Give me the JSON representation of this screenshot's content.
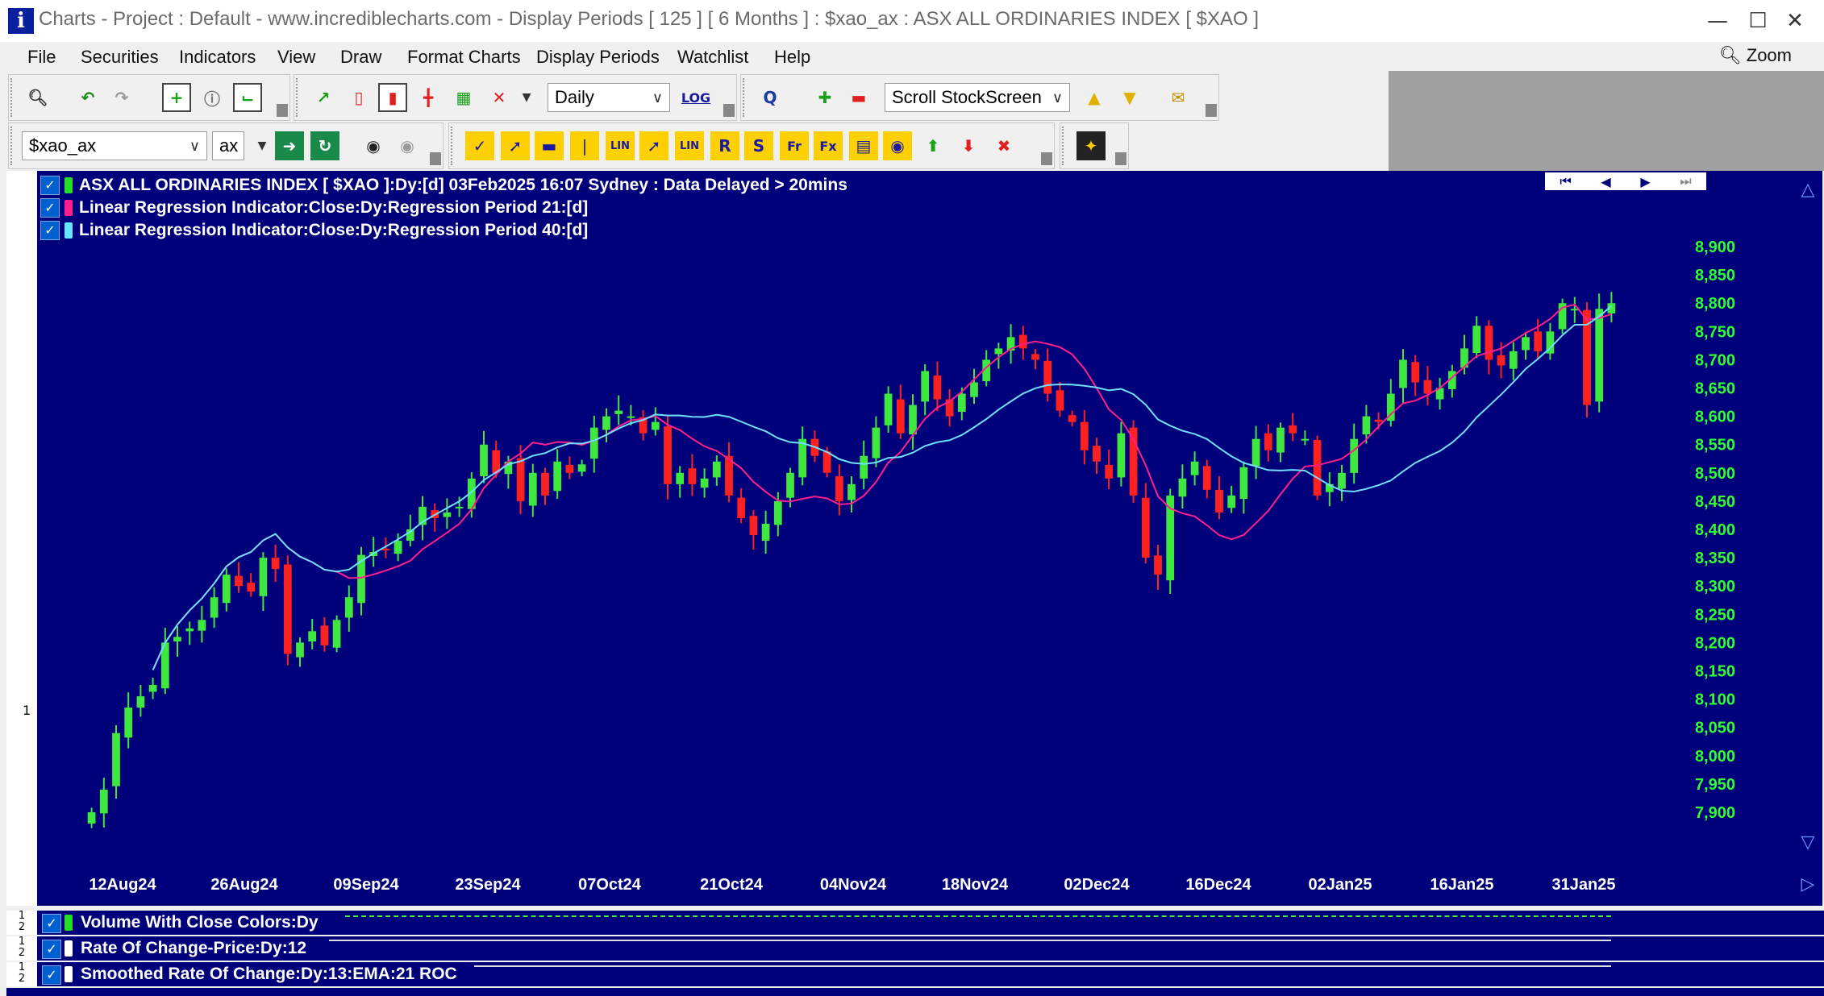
{
  "window": {
    "title": "Charts - Project : Default - www.incrediblecharts.com - Display Periods  [ 125 ]  [ 6 Months ] : $xao_ax : ASX ALL ORDINARIES INDEX  [ $XAO ]",
    "app_icon_letter": "i"
  },
  "menu": {
    "items": [
      "File",
      "Securities",
      "Indicators",
      "View",
      "Draw",
      "Format Charts",
      "Display Periods",
      "Watchlist",
      "Help"
    ],
    "zoom_label": "Zoom"
  },
  "toolbar": {
    "period_select": "Daily",
    "log_label": "LOG",
    "scroll_select": "Scroll StockScreen",
    "security_code": "$xao_ax",
    "exchange_code": "ax"
  },
  "legend": [
    {
      "label": "ASX ALL ORDINARIES INDEX [ $XAO ]:Dy:[d]  03Feb2025 16:07 Sydney : Data Delayed > 20mins",
      "color": "#22dd22"
    },
    {
      "label": "Linear Regression Indicator:Close:Dy:Regression Period 21:[d]",
      "color": "#ff1e8c"
    },
    {
      "label": "Linear Regression Indicator:Close:Dy:Regression Period 40:[d]",
      "color": "#66e6ff"
    }
  ],
  "pane_number": "1",
  "lower_panes": [
    {
      "num": "1\n2",
      "label": "Volume With Close Colors:Dy",
      "color": "#22dd22"
    },
    {
      "num": "1\n2",
      "label": "Rate Of Change-Price:Dy:12",
      "color": "#ffffff"
    },
    {
      "num": "1\n2",
      "label": "Smoothed Rate Of Change:Dy:13:EMA:21 ROC",
      "color": "#ffffff"
    }
  ],
  "chart_data": {
    "type": "candlestick",
    "y_ticks": [
      "7,900",
      "7,950",
      "8,000",
      "8,050",
      "8,100",
      "8,150",
      "8,200",
      "8,250",
      "8,300",
      "8,350",
      "8,400",
      "8,450",
      "8,500",
      "8,550",
      "8,600",
      "8,650",
      "8,700",
      "8,750",
      "8,800",
      "8,850",
      "8,900"
    ],
    "ylim": [
      7900,
      8900
    ],
    "x_ticks": [
      "12Aug24",
      "26Aug24",
      "09Sep24",
      "23Sep24",
      "07Oct24",
      "21Oct24",
      "04Nov24",
      "18Nov24",
      "02Dec24",
      "16Dec24",
      "02Jan25",
      "16Jan25",
      "31Jan25"
    ],
    "colors": {
      "up": "#3ee83e",
      "down": "#ff2020",
      "background": "#00007b",
      "axis_text": "#2eff2e",
      "lr21": "#ff1e8c",
      "lr40": "#6fe0ff"
    },
    "close": [
      7900,
      7940,
      8040,
      8085,
      8105,
      8125,
      8200,
      8210,
      8225,
      8240,
      8280,
      8320,
      8300,
      8290,
      8350,
      8330,
      8180,
      8200,
      8220,
      8195,
      8240,
      8280,
      8355,
      8360,
      8365,
      8380,
      8400,
      8440,
      8420,
      8430,
      8440,
      8490,
      8550,
      8500,
      8520,
      8450,
      8500,
      8460,
      8520,
      8500,
      8515,
      8580,
      8600,
      8610,
      8600,
      8570,
      8590,
      8480,
      8500,
      8480,
      8490,
      8520,
      8460,
      8420,
      8390,
      8410,
      8450,
      8500,
      8560,
      8530,
      8500,
      8450,
      8480,
      8530,
      8580,
      8640,
      8570,
      8620,
      8680,
      8630,
      8600,
      8640,
      8660,
      8700,
      8720,
      8740,
      8720,
      8700,
      8640,
      8610,
      8590,
      8540,
      8520,
      8490,
      8570,
      8460,
      8350,
      8320,
      8460,
      8490,
      8520,
      8470,
      8430,
      8460,
      8510,
      8560,
      8540,
      8580,
      8570,
      8560,
      8460,
      8480,
      8500,
      8560,
      8600,
      8590,
      8640,
      8700,
      8660,
      8640,
      8650,
      8680,
      8720,
      8760,
      8700,
      8690,
      8715,
      8740,
      8715,
      8750,
      8800,
      8790,
      8620,
      8790,
      8800
    ]
  }
}
